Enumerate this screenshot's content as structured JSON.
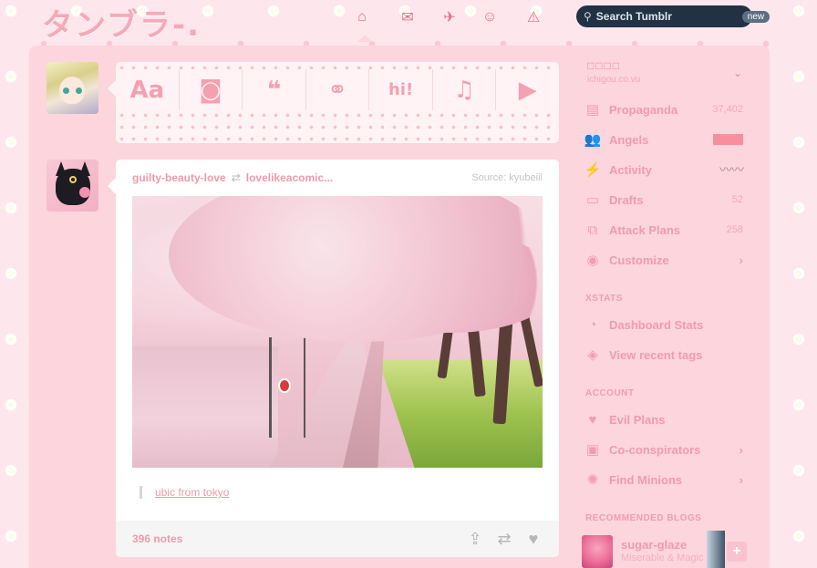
{
  "header": {
    "logo": "タンブラ-.",
    "nav": [
      {
        "name": "dashboard-home-icon",
        "glyph": "⌂"
      },
      {
        "name": "inbox-hearts-icon",
        "glyph": "✉"
      },
      {
        "name": "explore-map-icon",
        "glyph": "✈"
      },
      {
        "name": "activity-kitty-icon",
        "glyph": "☺"
      },
      {
        "name": "alert-icon",
        "glyph": "⚠"
      }
    ],
    "search": {
      "placeholder": "Search Tumblr",
      "badge": "new"
    }
  },
  "postbar": [
    {
      "name": "post-text-button",
      "glyph": "Aa"
    },
    {
      "name": "post-photo-button",
      "glyph": "◙"
    },
    {
      "name": "post-quote-button",
      "glyph": "❝"
    },
    {
      "name": "post-link-button",
      "glyph": "⚭"
    },
    {
      "name": "post-chat-button",
      "glyph": "hi!"
    },
    {
      "name": "post-audio-button",
      "glyph": "♫"
    },
    {
      "name": "post-video-button",
      "glyph": "▶"
    }
  ],
  "post": {
    "user": "guilty-beauty-love",
    "reblog_icon": "⇄",
    "reblogged_from": "lovelikeacomic...",
    "source": "Source: kyubeiil",
    "caption": "ubic from tokyo",
    "notes": "396 notes",
    "actions": [
      {
        "name": "share-icon",
        "glyph": "⇪"
      },
      {
        "name": "reblog-icon",
        "glyph": "⇄"
      },
      {
        "name": "like-heart-icon",
        "glyph": "♥"
      }
    ]
  },
  "sidebar": {
    "blog_name": "□□□□",
    "blog_url": "ichigou.co.vu",
    "chevron": "⌄",
    "items": [
      {
        "label": "Propaganda",
        "count": "37,402",
        "glyph": "▤",
        "icon": "posts-icon"
      },
      {
        "label": "Angels",
        "glyph": "👥",
        "icon": "followers-icon"
      },
      {
        "label": "Activity",
        "wave": "〰〰",
        "glyph": "⚡",
        "icon": "activity-icon"
      },
      {
        "label": "Drafts",
        "count": "52",
        "glyph": "▭",
        "icon": "drafts-icon"
      },
      {
        "label": "Attack Plans",
        "count": "258",
        "glyph": "⧉",
        "icon": "queue-icon"
      },
      {
        "label": "Customize",
        "arrow": "›",
        "glyph": "◉",
        "icon": "customize-eye-icon"
      }
    ],
    "xstats_head": "XSTATS",
    "xstats": [
      {
        "label": "Dashboard Stats",
        "glyph": "◔",
        "icon": "pie-chart-icon"
      },
      {
        "label": "View recent tags",
        "glyph": "◈",
        "icon": "tags-icon"
      }
    ],
    "account_head": "ACCOUNT",
    "account": [
      {
        "label": "Evil Plans",
        "glyph": "♥",
        "icon": "likes-heart-icon"
      },
      {
        "label": "Co-conspirators",
        "arrow": "›",
        "glyph": "▣",
        "icon": "following-icon"
      },
      {
        "label": "Find Minions",
        "arrow": "›",
        "glyph": "✺",
        "icon": "find-blogs-icon"
      }
    ],
    "recommended_head": "RECOMMENDED BLOGS",
    "recommended": {
      "name": "sugar-glaze",
      "subtitle": "Miserable & Magic",
      "follow": "+"
    }
  }
}
